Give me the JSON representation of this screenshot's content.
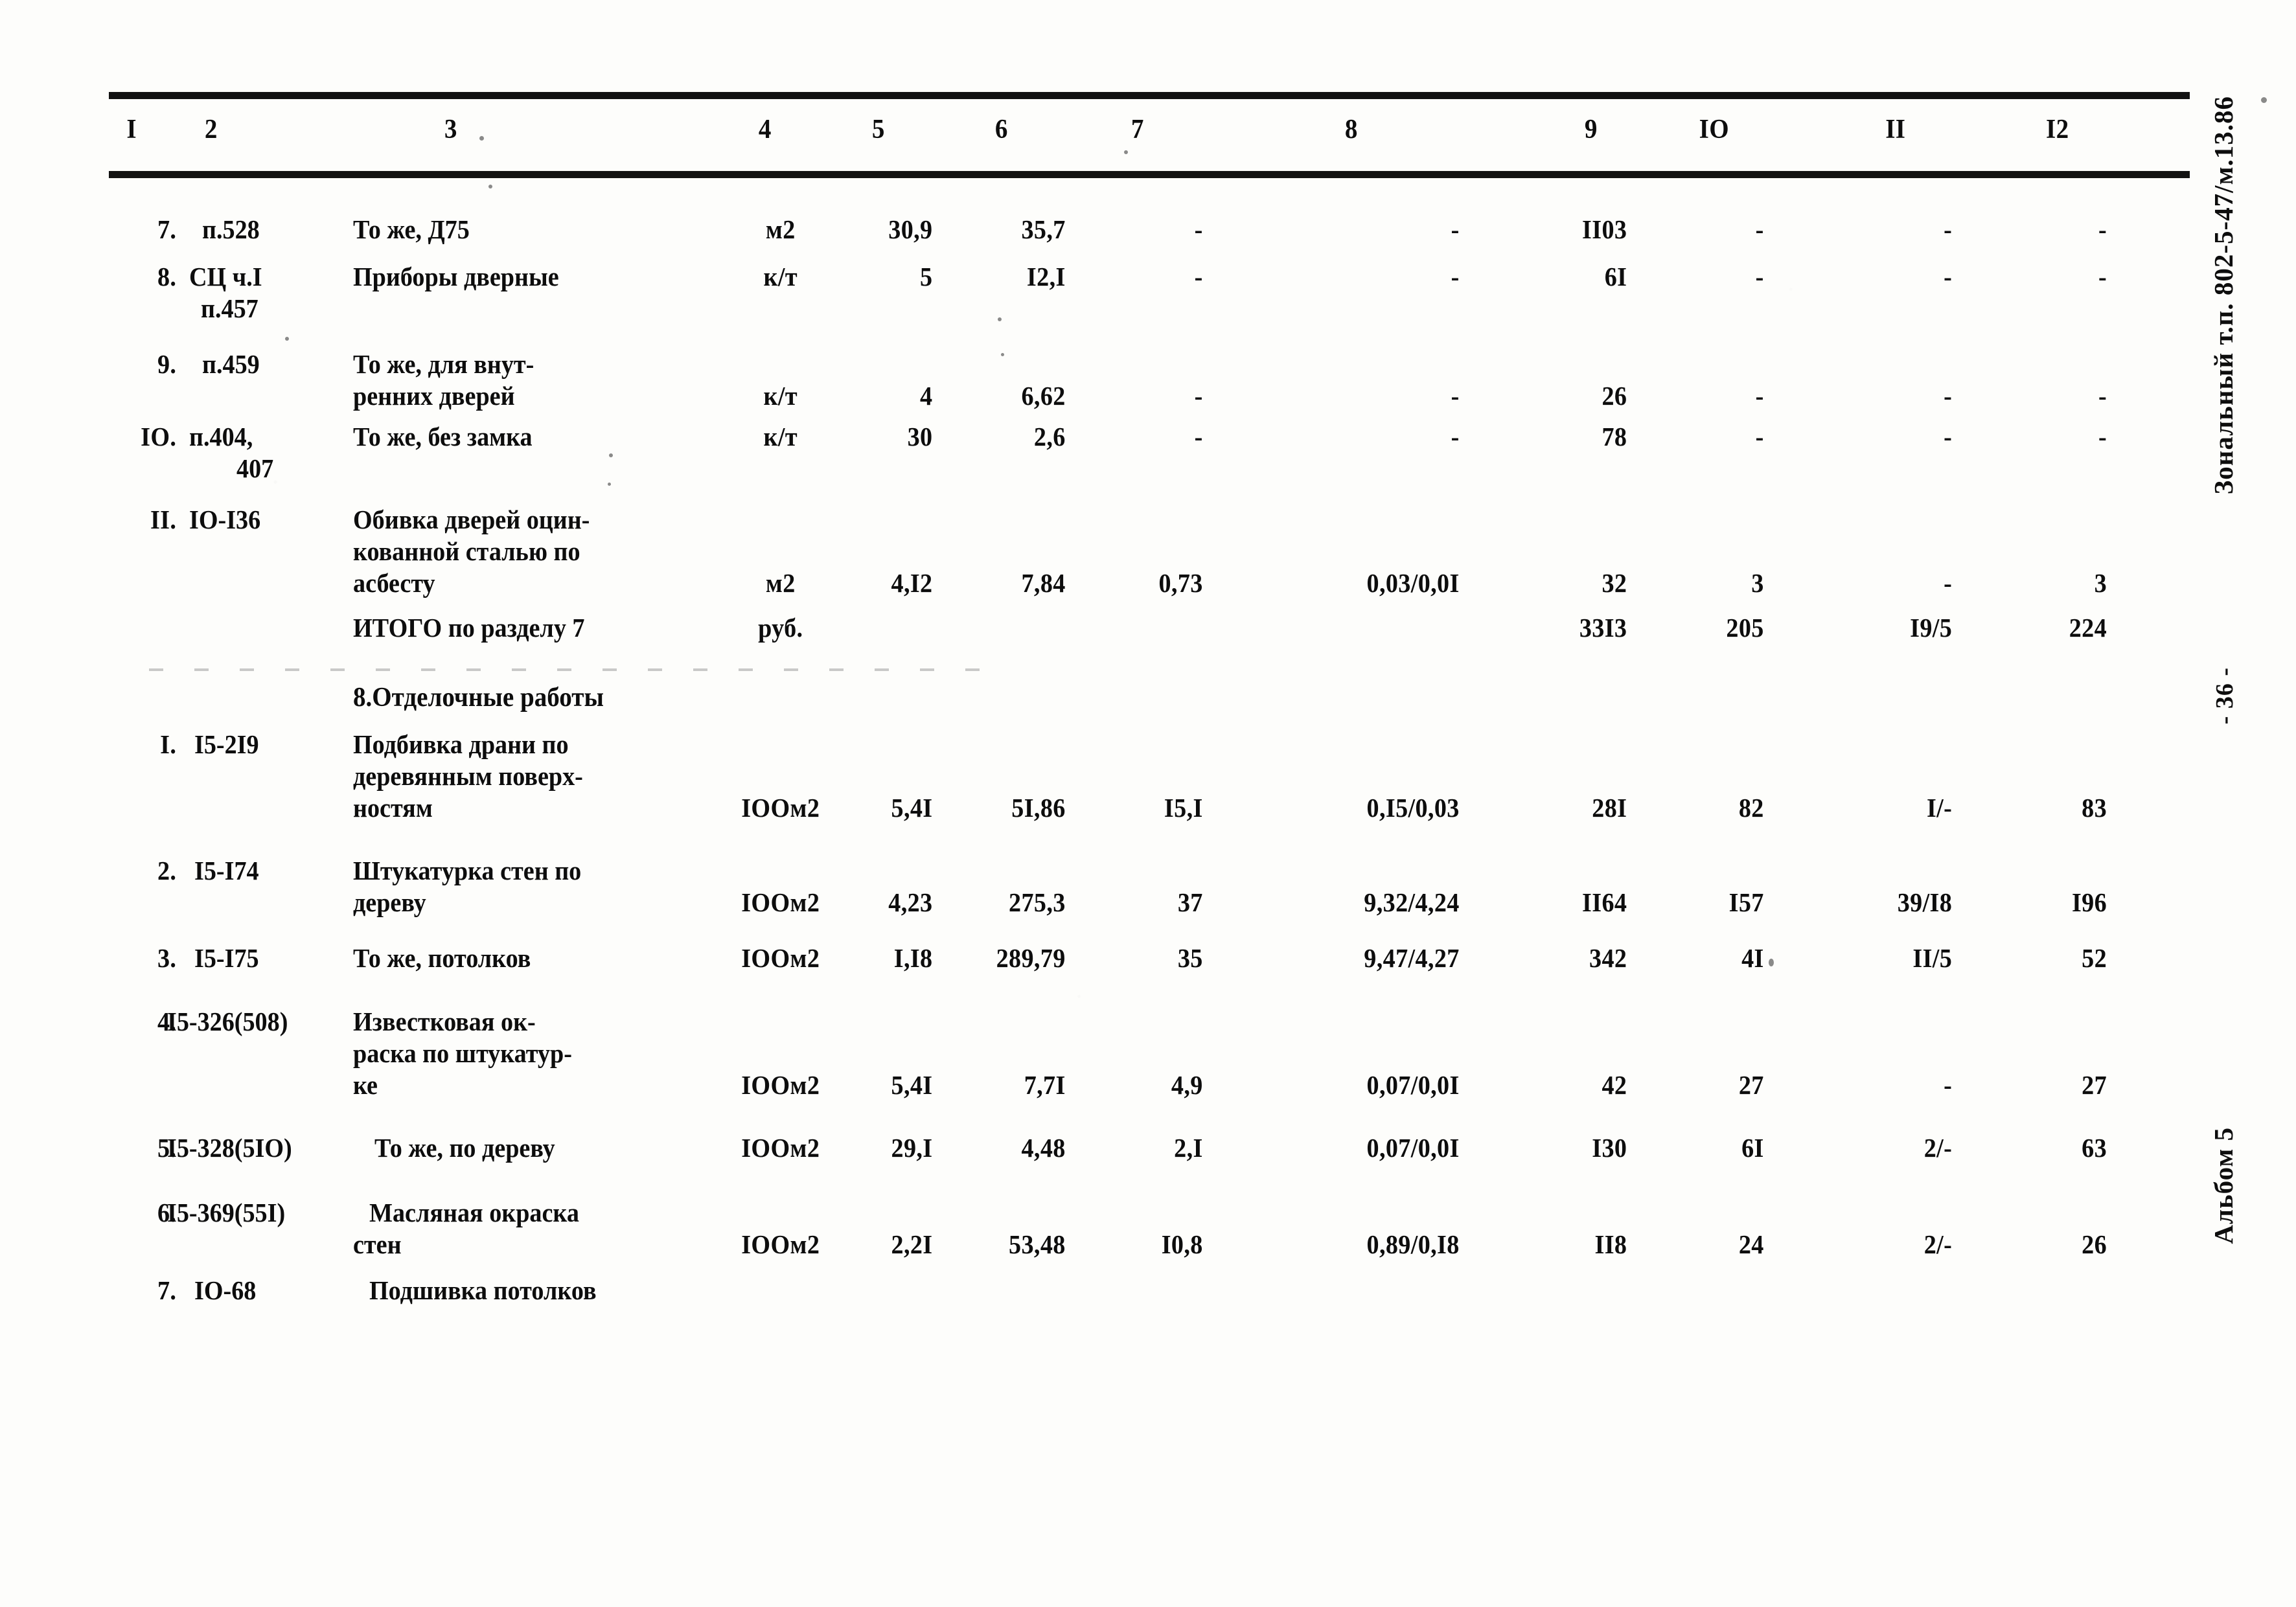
{
  "document": {
    "margin_reference": "Зональный т.п. 802-5-47/м.13.86",
    "margin_page": "- 36 -",
    "margin_album": "Альбом 5"
  },
  "table": {
    "column_headers": [
      "I",
      "2",
      "3",
      "4",
      "5",
      "6",
      "7",
      "8",
      "9",
      "IO",
      "II",
      "I2"
    ],
    "section_heading": "8.Отделочные работы",
    "total_row": {
      "label": "ИТОГО по разделу 7",
      "unit": "руб.",
      "col9": "33I3",
      "col10": "205",
      "col11": "I9/5",
      "col12": "224"
    },
    "rows": [
      {
        "num": "7.",
        "code": [
          "п.528"
        ],
        "desc": [
          "То же, Д75"
        ],
        "unit": "м2",
        "c5": "30,9",
        "c6": "35,7",
        "c7": "-",
        "c8": "-",
        "c9": "II03",
        "c10": "-",
        "c11": "-",
        "c12": "-"
      },
      {
        "num": "8.",
        "code": [
          "СЦ ч.I",
          "п.457"
        ],
        "desc": [
          "Приборы дверные"
        ],
        "unit": "к/т",
        "c5": "5",
        "c6": "I2,I",
        "c7": "-",
        "c8": "-",
        "c9": "6I",
        "c10": "-",
        "c11": "-",
        "c12": "-"
      },
      {
        "num": "9.",
        "code": [
          "п.459"
        ],
        "desc": [
          "То же, для внут-",
          "ренних дверей"
        ],
        "unit": "к/т",
        "c5": "4",
        "c6": "6,62",
        "c7": "-",
        "c8": "-",
        "c9": "26",
        "c10": "-",
        "c11": "-",
        "c12": "-"
      },
      {
        "num": "IO.",
        "code": [
          "п.404,",
          "407"
        ],
        "desc": [
          "То же, без замка"
        ],
        "unit": "к/т",
        "c5": "30",
        "c6": "2,6",
        "c7": "-",
        "c8": "-",
        "c9": "78",
        "c10": "-",
        "c11": "-",
        "c12": "-"
      },
      {
        "num": "II.",
        "code": [
          "IO-I36"
        ],
        "desc": [
          "Обивка дверей оцин-",
          "кованной сталью по",
          "асбесту"
        ],
        "unit": "м2",
        "c5": "4,I2",
        "c6": "7,84",
        "c7": "0,73",
        "c8": "0,03/0,0I",
        "c9": "32",
        "c10": "3",
        "c11": "-",
        "c12": "3"
      },
      {
        "num": "I.",
        "code": [
          "I5-2I9"
        ],
        "desc": [
          "Подбивка драни по",
          "деревянным поверх-",
          "ностям"
        ],
        "unit": "IOOм2",
        "c5": "5,4I",
        "c6": "5I,86",
        "c7": "I5,I",
        "c8": "0,I5/0,03",
        "c9": "28I",
        "c10": "82",
        "c11": "I/-",
        "c12": "83"
      },
      {
        "num": "2.",
        "code": [
          "I5-I74"
        ],
        "desc": [
          "Штукатурка стен по",
          "дереву"
        ],
        "unit": "IOOм2",
        "c5": "4,23",
        "c6": "275,3",
        "c7": "37",
        "c8": "9,32/4,24",
        "c9": "II64",
        "c10": "I57",
        "c11": "39/I8",
        "c12": "I96"
      },
      {
        "num": "3.",
        "code": [
          "I5-I75"
        ],
        "desc": [
          "То же, потолков"
        ],
        "unit": "IOOм2",
        "c5": "I,I8",
        "c6": "289,79",
        "c7": "35",
        "c8": "9,47/4,27",
        "c9": "342",
        "c10": "4I",
        "c11": "II/5",
        "c12": "52"
      },
      {
        "num": "4.",
        "code": [
          "I5-326(508)"
        ],
        "desc": [
          "Известковая ок-",
          "раска по штукатур-",
          "ке"
        ],
        "unit": "IOOм2",
        "c5": "5,4I",
        "c6": "7,7I",
        "c7": "4,9",
        "c8": "0,07/0,0I",
        "c9": "42",
        "c10": "27",
        "c11": "-",
        "c12": "27"
      },
      {
        "num": "5.",
        "code": [
          "I5-328(5IO)"
        ],
        "desc": [
          "То же, по дереву"
        ],
        "unit": "IOOм2",
        "c5": "29,I",
        "c6": "4,48",
        "c7": "2,I",
        "c8": "0,07/0,0I",
        "c9": "I30",
        "c10": "6I",
        "c11": "2/-",
        "c12": "63"
      },
      {
        "num": "6.",
        "code": [
          "I5-369(55I)"
        ],
        "desc": [
          "Масляная окраска",
          "стен"
        ],
        "unit": "IOOм2",
        "c5": "2,2I",
        "c6": "53,48",
        "c7": "I0,8",
        "c8": "0,89/0,I8",
        "c9": "II8",
        "c10": "24",
        "c11": "2/-",
        "c12": "26"
      },
      {
        "num": "7.",
        "code": [
          "IO-68"
        ],
        "desc": [
          "Подшивка потолков"
        ],
        "unit": "",
        "c5": "",
        "c6": "",
        "c7": "",
        "c8": "",
        "c9": "",
        "c10": "",
        "c11": "",
        "c12": ""
      }
    ]
  }
}
